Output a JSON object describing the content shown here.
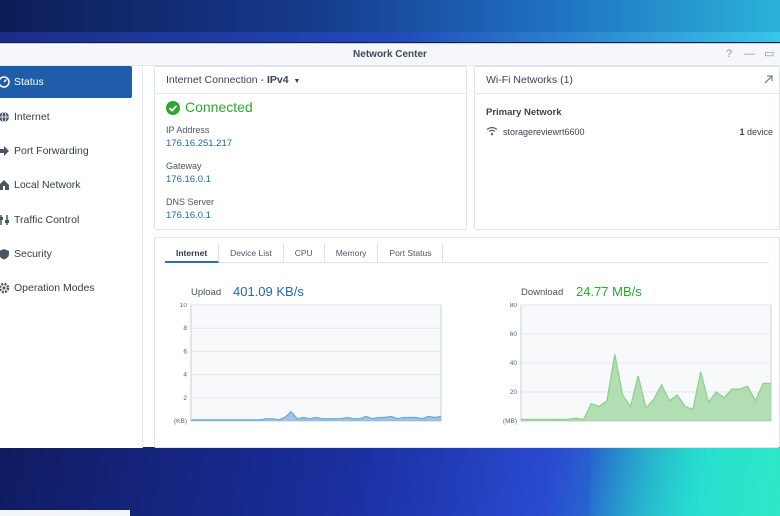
{
  "window": {
    "title": "Network Center",
    "controls": [
      "?",
      "—",
      "▭"
    ]
  },
  "sidebar": {
    "items": [
      {
        "label": "Status",
        "icon": "gauge-icon",
        "active": true
      },
      {
        "label": "Internet",
        "icon": "globe-icon",
        "active": false
      },
      {
        "label": "Port Forwarding",
        "icon": "arrow-icon",
        "active": false
      },
      {
        "label": "Local Network",
        "icon": "home-network-icon",
        "active": false
      },
      {
        "label": "Traffic Control",
        "icon": "sliders-icon",
        "active": false
      },
      {
        "label": "Security",
        "icon": "shield-icon",
        "active": false
      },
      {
        "label": "Operation Modes",
        "icon": "gear-icon",
        "active": false
      }
    ]
  },
  "internet": {
    "heading": "Internet Connection - ",
    "protocol": "IPv4",
    "status": "Connected",
    "status_color": "#2ea62e",
    "ip_label": "IP Address",
    "ip_value": "176.16.251.217",
    "gateway_label": "Gateway",
    "gateway_value": "176.16.0.1",
    "dns_label": "DNS Server",
    "dns_value": "176.16.0.1"
  },
  "wifi": {
    "heading": "Wi-Fi Networks (1)",
    "primary_label": "Primary Network",
    "ssid": "storagereviewrt6600",
    "device_count": "1",
    "device_suffix": " device"
  },
  "monitor": {
    "tabs": [
      {
        "label": "Internet",
        "active": true
      },
      {
        "label": "Device List",
        "active": false
      },
      {
        "label": "CPU",
        "active": false
      },
      {
        "label": "Memory",
        "active": false
      },
      {
        "label": "Port Status",
        "active": false
      }
    ],
    "upload_label": "Upload",
    "upload_rate": "401.09 KB/s",
    "upload_color": "#2367ae",
    "download_label": "Download",
    "download_rate": "24.77 MB/s",
    "download_color": "#2ea62e"
  },
  "chart_data": [
    {
      "type": "area",
      "title": "Upload",
      "ylabel": "(KB)",
      "ylim": [
        0,
        10
      ],
      "yticks": [
        2,
        4,
        6,
        8,
        10
      ],
      "values": [
        0.1,
        0.1,
        0.1,
        0.1,
        0.1,
        0.1,
        0.1,
        0.1,
        0.1,
        0.1,
        0.1,
        0.1,
        0.2,
        0.2,
        0.1,
        0.3,
        0.8,
        0.2,
        0.3,
        0.2,
        0.3,
        0.2,
        0.2,
        0.2,
        0.2,
        0.3,
        0.2,
        0.2,
        0.4,
        0.2,
        0.3,
        0.3,
        0.4,
        0.2,
        0.3,
        0.3,
        0.3,
        0.2,
        0.4,
        0.3,
        0.4
      ],
      "color": "#6fa9d8"
    },
    {
      "type": "area",
      "title": "Download",
      "ylabel": "(MB)",
      "ylim": [
        0,
        80
      ],
      "yticks": [
        20,
        40,
        60,
        80
      ],
      "values": [
        1,
        1,
        1,
        1,
        1,
        1,
        1,
        2,
        1,
        12,
        10,
        14,
        46,
        18,
        10,
        31,
        9,
        15,
        25,
        14,
        18,
        10,
        8,
        34,
        13,
        20,
        16,
        22,
        22,
        24,
        14,
        26,
        26
      ],
      "color": "#8ccf8c"
    }
  ]
}
